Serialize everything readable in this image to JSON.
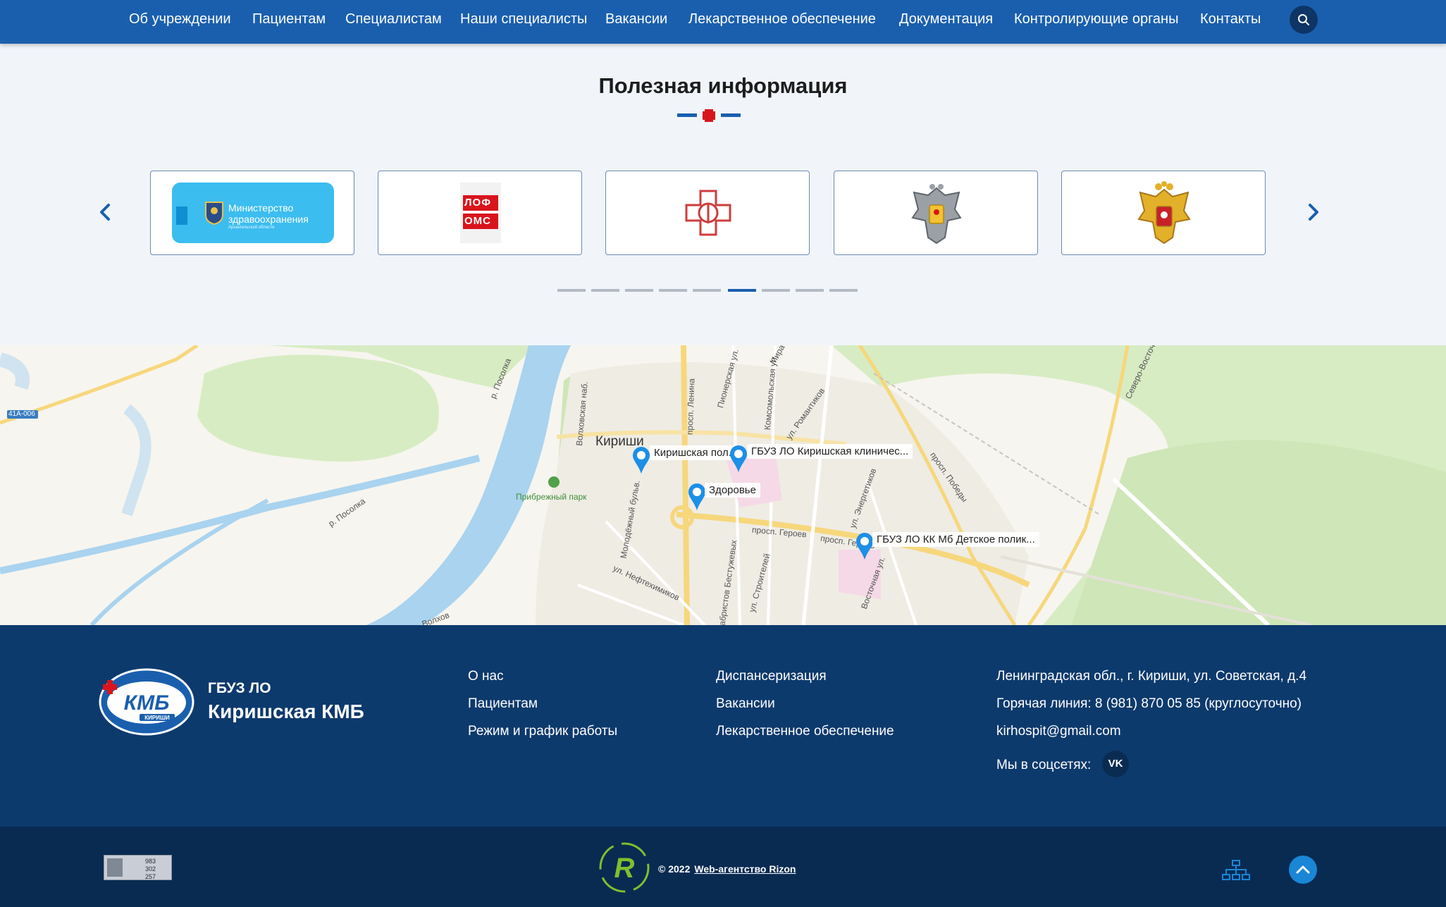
{
  "nav": {
    "items": [
      "Об учреждении",
      "Пациентам",
      "Специалистам",
      "Наши специалисты",
      "Вакансии",
      "Лекарственное обеспечение",
      "Документация",
      "Контролирующие органы",
      "Контакты"
    ]
  },
  "useful_info": {
    "title": "Полезная информация",
    "cards": [
      {
        "name": "ministry",
        "line1": "Министерство",
        "line2": "здравоохранения",
        "line3": "Архангельской области"
      },
      {
        "name": "lofoms",
        "line1": "ЛОФ",
        "line2": "ОМС"
      },
      {
        "name": "roszdravnadzor"
      },
      {
        "name": "rospotrebnadzor"
      },
      {
        "name": "russia-coat"
      }
    ],
    "pagination": {
      "count": 9,
      "active": 6
    }
  },
  "map": {
    "labels": {
      "city": "Кириши",
      "park": "Прибрежный парк",
      "road": "41А-006",
      "river1": "р. Посолка",
      "river2": "р. Посолка",
      "volkhov": "Волхов",
      "street_lenina": "просп. Ленина",
      "street_geroev": "просп. Героев",
      "street_pobedy": "просп. Победы",
      "street_neftekhimikov": "ул. Нефтехимиков",
      "street_stroiteley": "ул. Строителей",
      "street_volkhovskaya": "Волховская наб.",
      "street_molodezhny": "Молодёжный бульв.",
      "street_komsomolskaya": "Комсомольская ул.",
      "street_pionerskaya": "Пионерская ул.",
      "street_energetikov": "ул. Энергетиков",
      "street_romantikov": "ул. Романтиков",
      "street_mira": "Мира",
      "street_vostochnaya": "Восточная ул.",
      "street_dekabristov": "Декабристов Бестужевых",
      "street_severo": "Северо-Восточ"
    },
    "pins": [
      {
        "label": "Киришская пол..."
      },
      {
        "label": "ГБУЗ ЛО Киришская клиничес..."
      },
      {
        "label": "Здоровье"
      },
      {
        "label": "ГБУЗ ЛО КК Мб Детское полик..."
      }
    ]
  },
  "footer": {
    "logo_text": "КМБ",
    "logo_sub": "КИРИШИ",
    "org_line1": "ГБУЗ ЛО",
    "org_line2": "Киришская КМБ",
    "col1": [
      "О нас",
      "Пациентам",
      "Режим и график работы"
    ],
    "col2": [
      "Диспансеризация",
      "Вакансии",
      "Лекарственное обеспечение"
    ],
    "address": "Ленинградская обл., г. Кириши, ул. Советская, д.4",
    "hotline": "Горячая линия: 8 (981) 870 05 85 (круглосуточно)",
    "email": "kirhospit@gmail.com",
    "social_label": "Мы в соцсетях:",
    "vk": "VK"
  },
  "bottom": {
    "counter": [
      "983",
      "302",
      "257"
    ],
    "copyright": "© 2022",
    "agency_link": "Web-агентство Rizon"
  },
  "colors": {
    "nav_bg": "#1a5fae",
    "footer_bg": "#0d3a6d",
    "bottom_bg": "#092b52",
    "accent_red": "#d9141c"
  }
}
